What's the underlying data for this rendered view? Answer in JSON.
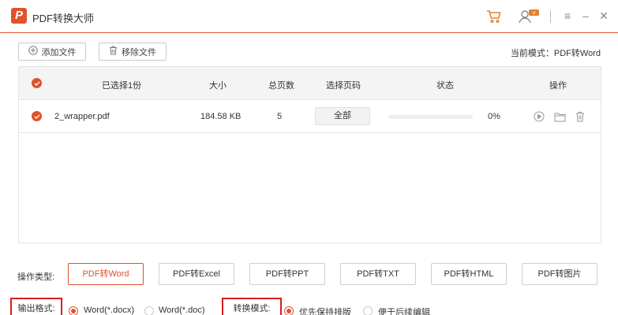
{
  "app": {
    "logo_letter": "P",
    "title": "PDF转换大师"
  },
  "window_controls": {
    "menu": "≡",
    "minimize": "–",
    "close": "✕"
  },
  "toolbar": {
    "add_file": "添加文件",
    "remove_file": "移除文件",
    "current_mode": "当前模式：PDF转Word"
  },
  "table": {
    "headers": {
      "selected": "已选择1份",
      "size": "大小",
      "pages": "总页数",
      "select_pages": "选择页码",
      "status": "状态",
      "actions": "操作"
    },
    "rows": [
      {
        "name": "2_wrapper.pdf",
        "size": "184.58 KB",
        "pages": "5",
        "page_range": "全部",
        "progress_percent": 0,
        "progress_text": "0%"
      }
    ]
  },
  "operation": {
    "label": "操作类型:",
    "types": [
      "PDF转Word",
      "PDF转Excel",
      "PDF转PPT",
      "PDF转TXT",
      "PDF转HTML",
      "PDF转图片"
    ],
    "active_index": 0
  },
  "output": {
    "format_label": "输出格式:",
    "formats": [
      "Word(*.docx)",
      "Word(*.doc)"
    ],
    "selected_format": 0,
    "mode_label": "转换模式:",
    "modes": [
      "优先保持排版",
      "便于后续编辑"
    ],
    "selected_mode": 0
  },
  "colors": {
    "accent": "#e0522c",
    "highlight_box": "#d81e1e"
  }
}
